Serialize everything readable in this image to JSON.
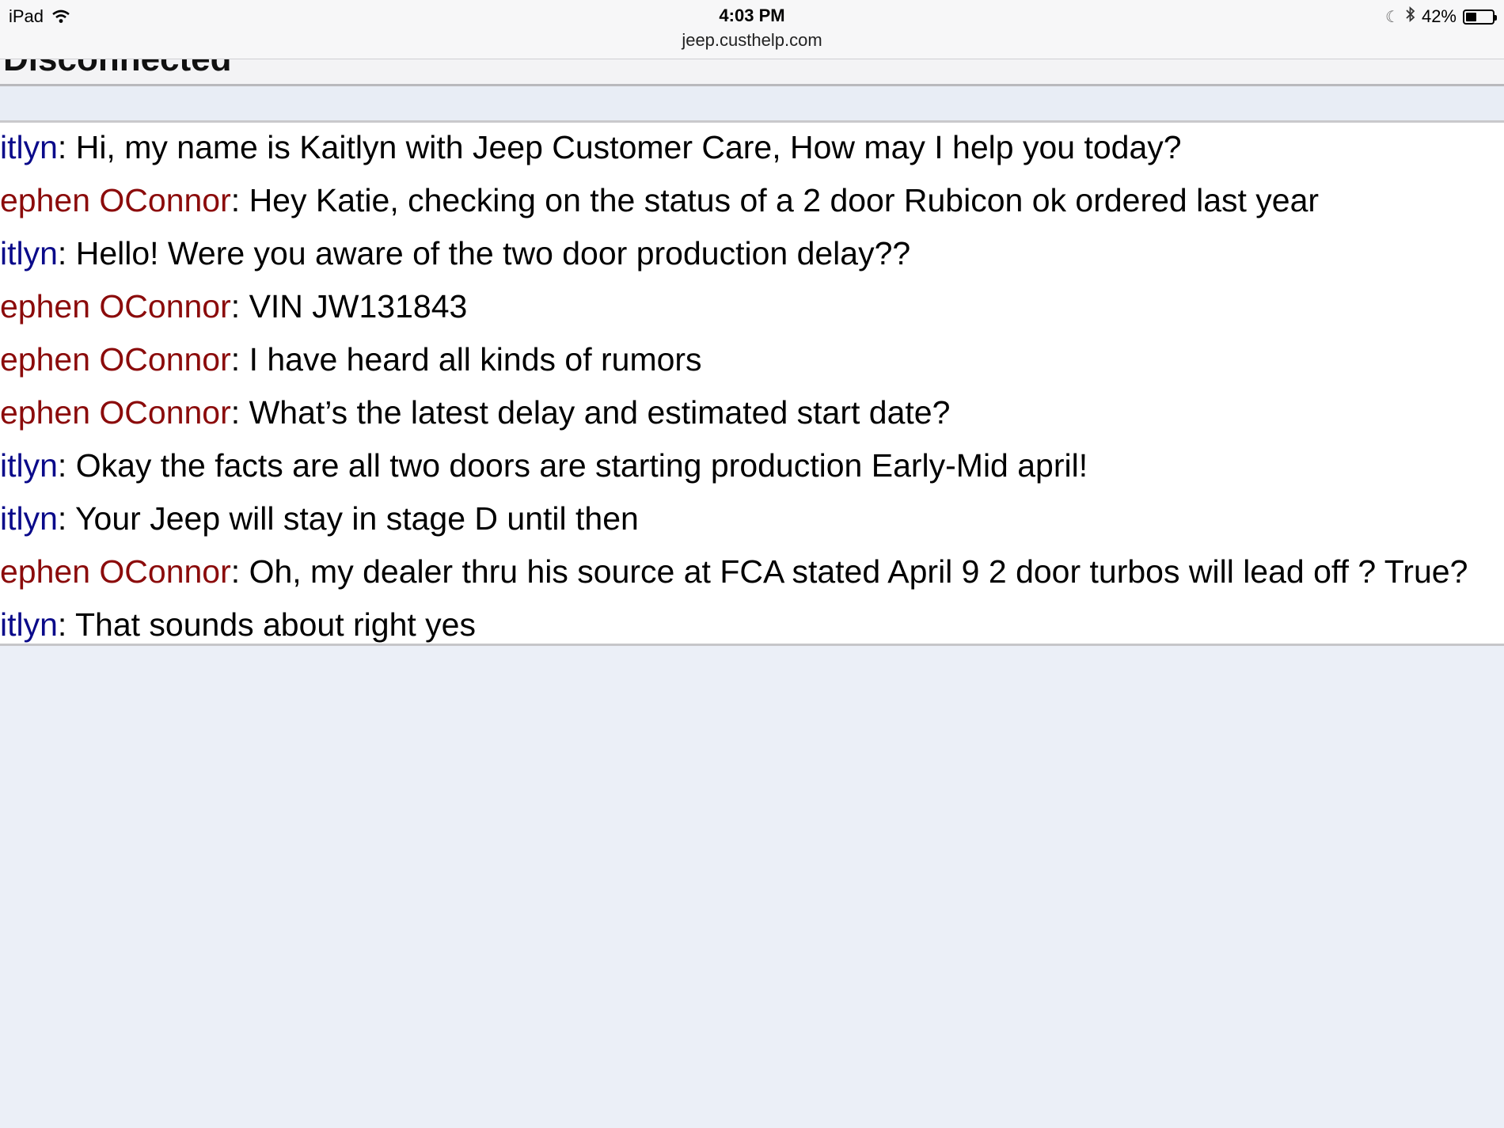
{
  "status_bar": {
    "device": "iPad",
    "time": "4:03 PM",
    "url": "jeep.custhelp.com",
    "battery_percent": "42%",
    "battery_level": 0.42,
    "icons": [
      "wifi-icon",
      "moon-icon",
      "bluetooth-icon",
      "battery-icon"
    ]
  },
  "page": {
    "title": "Disconnected"
  },
  "colors": {
    "agent_name": "#0a0a8a",
    "customer_name": "#8b0b0b",
    "page_background": "#ebeff7"
  },
  "transcript": [
    {
      "speaker": "itlyn",
      "role": "agent",
      "separator": ":",
      "text": " Hi, my name is Kaitlyn with Jeep Customer Care, How may I help you today?"
    },
    {
      "speaker": "ephen OConnor",
      "role": "customer",
      "separator": ":",
      "text": " Hey Katie, checking on the status of a 2 door Rubicon ok ordered last year"
    },
    {
      "speaker": "itlyn",
      "role": "agent",
      "separator": ":",
      "text": " Hello! Were you aware of the two door production delay??"
    },
    {
      "speaker": "ephen OConnor",
      "role": "customer",
      "separator": ":",
      "text": " VIN JW131843"
    },
    {
      "speaker": "ephen OConnor",
      "role": "customer",
      "separator": ":",
      "text": " I have heard all kinds of rumors"
    },
    {
      "speaker": "ephen OConnor",
      "role": "customer",
      "separator": ":",
      "text": " What’s the latest delay and estimated start date?"
    },
    {
      "speaker": "itlyn",
      "role": "agent",
      "separator": ":",
      "text": " Okay the facts are all two doors are starting production Early-Mid april!"
    },
    {
      "speaker": "itlyn",
      "role": "agent",
      "separator": ":",
      "text": " Your Jeep will stay in stage D until then"
    },
    {
      "speaker": "ephen OConnor",
      "role": "customer",
      "separator": ":",
      "text": " Oh, my dealer thru his source at FCA stated April 9 2 door turbos will lead off ? True?"
    },
    {
      "speaker": "itlyn",
      "role": "agent",
      "separator": ":",
      "text": " That sounds about right yes"
    }
  ]
}
